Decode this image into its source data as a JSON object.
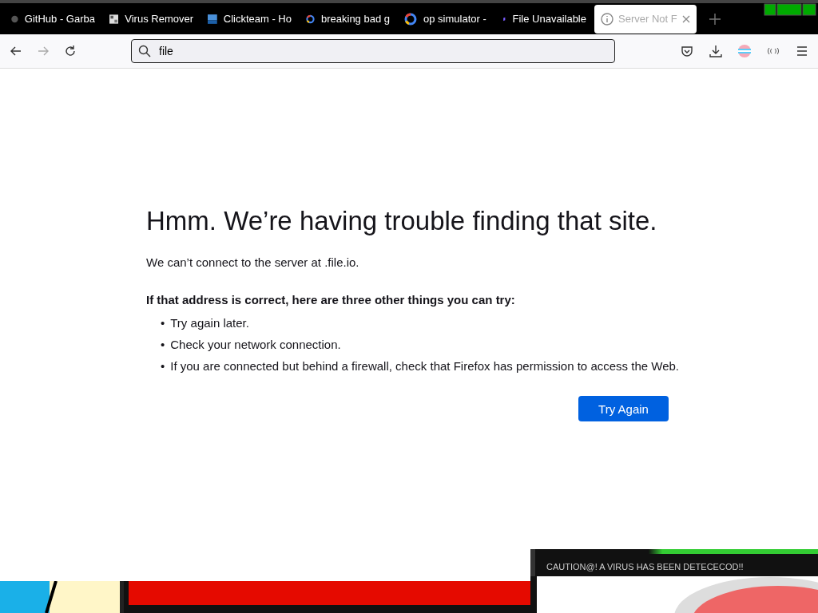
{
  "tabs": [
    {
      "title": "GitHub - Garba",
      "selected": false
    },
    {
      "title": "Virus Remover",
      "selected": false
    },
    {
      "title": "Clickteam - Ho",
      "selected": false
    },
    {
      "title": "breaking bad g",
      "selected": false
    },
    {
      "title": "op simulator -",
      "selected": false
    },
    {
      "title": "File Unavailable",
      "selected": false
    },
    {
      "title": "Server Not F",
      "selected": true
    }
  ],
  "address_bar": {
    "value": "file"
  },
  "error_page": {
    "title": "Hmm. We’re having trouble finding that site.",
    "message": "We can’t connect to the server at .file.io.",
    "tips_heading": "If that address is correct, here are three other things you can try:",
    "tips": [
      {
        "bullet": "•",
        "text": "Try again later."
      },
      {
        "bullet": "•",
        "text": "Check your network connection."
      },
      {
        "bullet": "•",
        "text": "If you are connected but behind a firewall, check that Firefox has permission to access the Web."
      }
    ],
    "button": "Try Again"
  },
  "popup": {
    "title": "CAUTION@! A VIRUS HAS BEEN DETECECOD!!"
  }
}
